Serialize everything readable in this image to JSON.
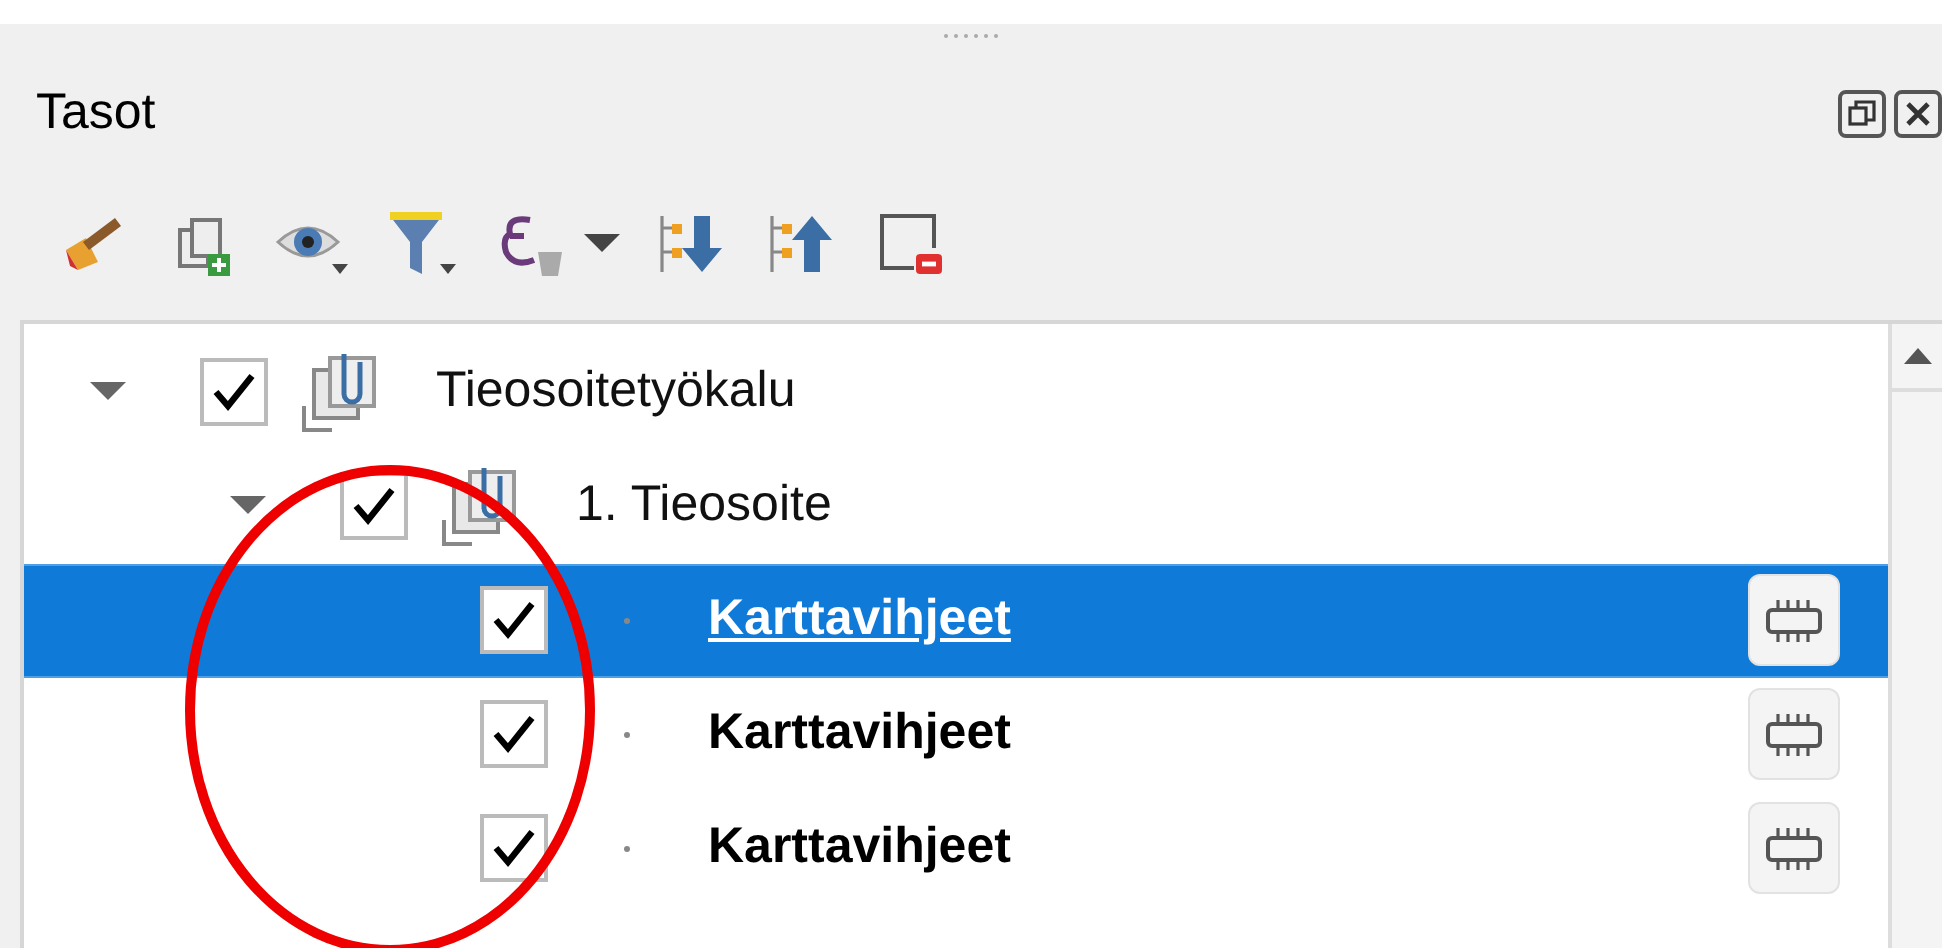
{
  "panel": {
    "title": "Tasot"
  },
  "layers": [
    {
      "kind": "group",
      "name": "Tieosoitetyökalu",
      "checked": true,
      "expanded": true,
      "selected": false,
      "children": [
        {
          "kind": "group",
          "name": "1. Tieosoite",
          "checked": true,
          "expanded": true,
          "selected": false,
          "children": [
            {
              "kind": "layer",
              "name": "Karttavihjeet",
              "checked": true,
              "selected": true
            },
            {
              "kind": "layer",
              "name": "Karttavihjeet",
              "checked": true,
              "selected": false
            },
            {
              "kind": "layer",
              "name": "Karttavihjeet",
              "checked": true,
              "selected": false
            }
          ]
        }
      ]
    }
  ]
}
